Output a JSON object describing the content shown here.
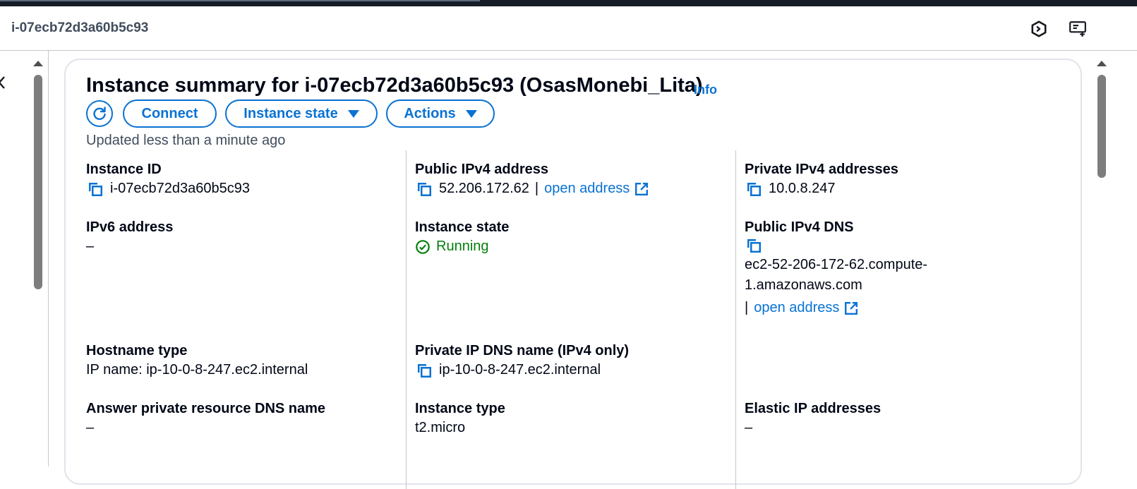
{
  "header": {
    "title": "i-07ecb72d3a60b5c93",
    "icons": [
      "cloudshell-icon",
      "feedback-screen-icon"
    ]
  },
  "summary": {
    "title": "Instance summary for i-07ecb72d3a60b5c93 (OsasMonebi_Lita)",
    "info_label": "Info",
    "updated_text": "Updated less than a minute ago",
    "buttons": {
      "connect": "Connect",
      "instance_state": "Instance state",
      "actions": "Actions"
    }
  },
  "details": {
    "instance_id": {
      "label": "Instance ID",
      "value": "i-07ecb72d3a60b5c93"
    },
    "public_ipv4": {
      "label": "Public IPv4 address",
      "value": "52.206.172.62",
      "separator": "|",
      "link": "open address"
    },
    "private_ipv4": {
      "label": "Private IPv4 addresses",
      "value": "10.0.8.247"
    },
    "ipv6": {
      "label": "IPv6 address",
      "value": "–"
    },
    "instance_state": {
      "label": "Instance state",
      "value": "Running"
    },
    "public_dns": {
      "label": "Public IPv4 DNS",
      "value_line1": "ec2-52-206-172-62.compute-",
      "value_line2": "1.amazonaws.com",
      "separator": "|",
      "link": "open address"
    },
    "hostname_type": {
      "label": "Hostname type",
      "value": "IP name: ip-10-0-8-247.ec2.internal"
    },
    "private_dns": {
      "label": "Private IP DNS name (IPv4 only)",
      "value": "ip-10-0-8-247.ec2.internal"
    },
    "answer_dns": {
      "label": "Answer private resource DNS name",
      "value": "–"
    },
    "instance_type": {
      "label": "Instance type",
      "value": "t2.micro"
    },
    "elastic_ip": {
      "label": "Elastic IP addresses",
      "value": "–"
    }
  },
  "colors": {
    "link": "#0972d3",
    "success": "#037f0c",
    "text": "#000716",
    "muted": "#414d5c",
    "divider": "#c6c6cd",
    "top_bar": "#161d26"
  }
}
